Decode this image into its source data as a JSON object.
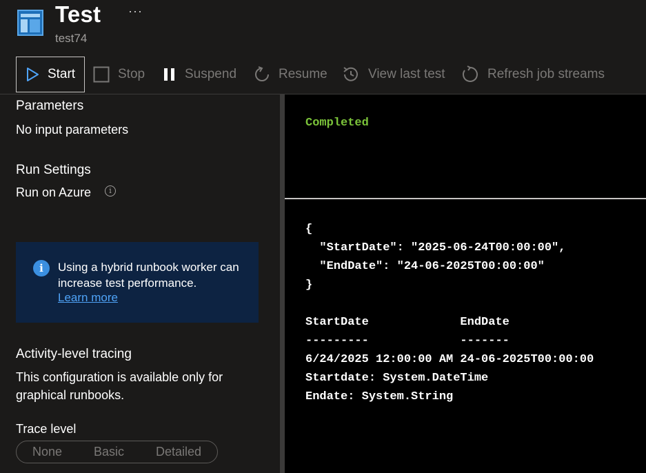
{
  "header": {
    "title": "Test",
    "subtitle": "test74",
    "more_label": "···",
    "icon": "runbook-window-icon"
  },
  "toolbar": {
    "start": {
      "label": "Start",
      "icon": "play-icon",
      "enabled": true
    },
    "stop": {
      "label": "Stop",
      "icon": "stop-icon",
      "enabled": false
    },
    "suspend": {
      "label": "Suspend",
      "icon": "pause-icon",
      "enabled": false
    },
    "resume": {
      "label": "Resume",
      "icon": "resume-icon",
      "enabled": false
    },
    "view_last_test": {
      "label": "View last test",
      "icon": "history-icon",
      "enabled": false
    },
    "refresh": {
      "label": "Refresh job streams",
      "icon": "refresh-icon",
      "enabled": false
    }
  },
  "left": {
    "parameters_heading": "Parameters",
    "parameters_text": "No input parameters",
    "run_settings_heading": "Run Settings",
    "run_on_label": "Run on Azure",
    "info_icon_glyph": "i",
    "info_box": {
      "message": "Using a hybrid runbook worker can increase test performance.",
      "link": "Learn more",
      "icon_glyph": "i"
    },
    "activity_heading": "Activity-level tracing",
    "activity_text_1": "This configuration is available only for",
    "activity_text_2": "graphical runbooks.",
    "trace_level_label": "Trace level",
    "trace_options": [
      "None",
      "Basic",
      "Detailed"
    ]
  },
  "output": {
    "status": "Completed",
    "lines": [
      "{",
      "  \"StartDate\": \"2025-06-24T00:00:00\",",
      "  \"EndDate\": \"24-06-2025T00:00:00\"",
      "}",
      "",
      "StartDate             EndDate",
      "---------             -------",
      "6/24/2025 12:00:00 AM 24-06-2025T00:00:00",
      "Startdate: System.DateTime",
      "Endate: System.String"
    ]
  },
  "colors": {
    "background": "#1b1a19",
    "output_background": "#000000",
    "status_green": "#7bc33a",
    "info_box": "#0d2342",
    "link_blue": "#4fa3f7",
    "disabled_text": "#7a7876"
  }
}
